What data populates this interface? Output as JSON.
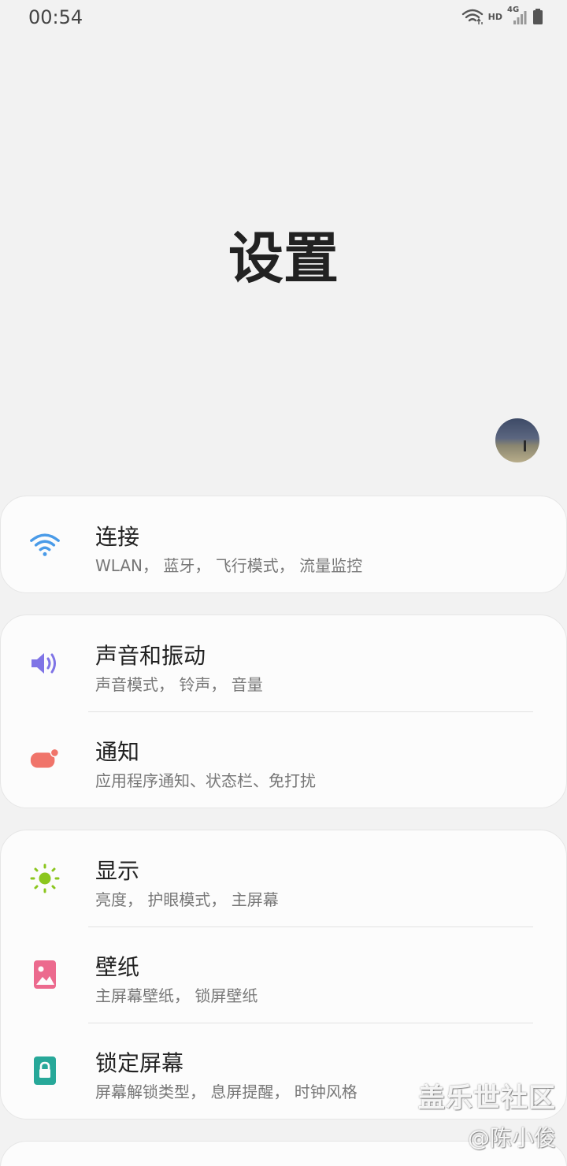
{
  "status_bar": {
    "time": "00:54",
    "hd_label": "HD",
    "network_label": "4G",
    "icons": [
      "wifi-icon",
      "hd-icon",
      "signal-4g-icon",
      "battery-icon"
    ]
  },
  "header": {
    "title": "设置",
    "avatar_icon": "profile-avatar"
  },
  "cards": [
    {
      "items": [
        {
          "icon": "wifi-icon",
          "icon_color": "#4a9be8",
          "title": "连接",
          "subtitle": "WLAN， 蓝牙， 飞行模式， 流量监控"
        }
      ]
    },
    {
      "items": [
        {
          "icon": "volume-icon",
          "icon_color": "#7f74e6",
          "title": "声音和振动",
          "subtitle": "声音模式， 铃声， 音量"
        },
        {
          "icon": "notification-icon",
          "icon_color": "#f0746a",
          "title": "通知",
          "subtitle": "应用程序通知、状态栏、免打扰"
        }
      ]
    },
    {
      "items": [
        {
          "icon": "brightness-icon",
          "icon_color": "#8bc61e",
          "title": "显示",
          "subtitle": "亮度， 护眼模式， 主屏幕"
        },
        {
          "icon": "wallpaper-icon",
          "icon_color": "#ec6a8e",
          "title": "壁纸",
          "subtitle": "主屏幕壁纸， 锁屏壁纸"
        },
        {
          "icon": "lock-icon",
          "icon_color": "#27a899",
          "title": "锁定屏幕",
          "subtitle": "屏幕解锁类型， 息屏提醒， 时钟风格"
        }
      ]
    }
  ],
  "watermark": {
    "line1": "盖乐世社区",
    "line2": "@陈小俊"
  }
}
